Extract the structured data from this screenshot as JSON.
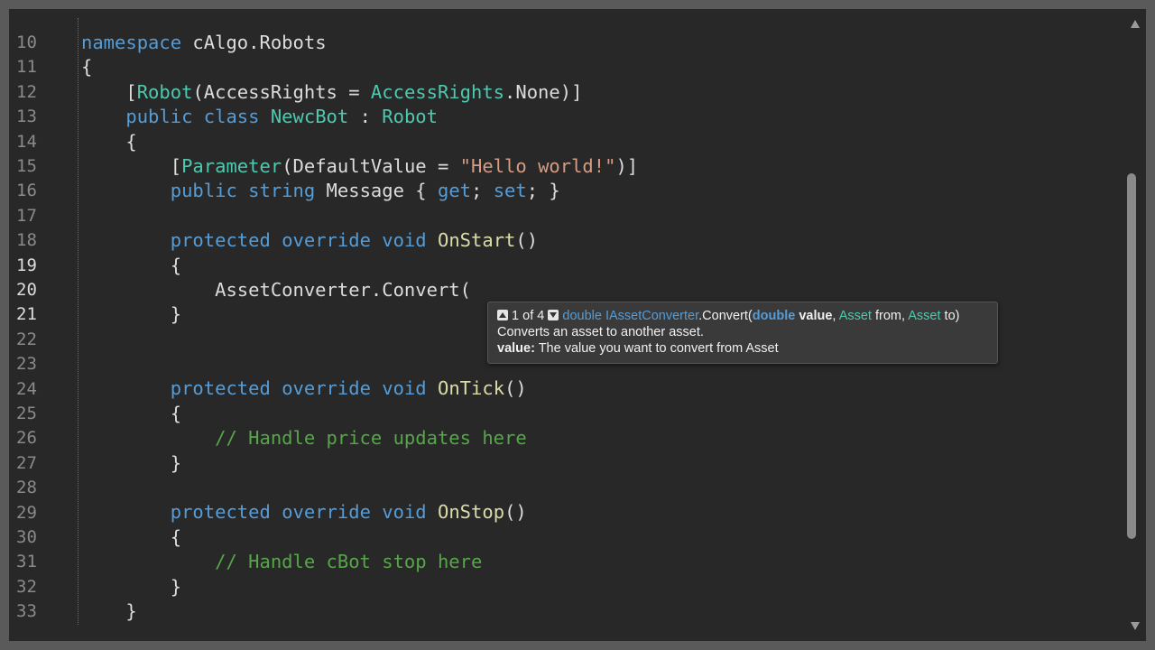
{
  "editor": {
    "line_numbers": [
      "10",
      "11",
      "12",
      "13",
      "14",
      "15",
      "16",
      "17",
      "18",
      "19",
      "20",
      "21",
      "22",
      "23",
      "24",
      "25",
      "26",
      "27",
      "28",
      "29",
      "30",
      "31",
      "32",
      "33"
    ],
    "active_lines": [
      "19",
      "20",
      "21"
    ],
    "code": {
      "l10": {
        "kw": "namespace",
        "rest": " cAlgo.Robots"
      },
      "l11": {
        "text": "{"
      },
      "l12": {
        "indent": "    ",
        "open": "[",
        "attr": "Robot",
        "mid": "(AccessRights = ",
        "type": "AccessRights",
        "end": ".None)]"
      },
      "l13": {
        "indent": "    ",
        "kw1": "public",
        "kw2": "class",
        "name": "NewcBot",
        "colon": " : ",
        "base": "Robot"
      },
      "l14": {
        "text": "    {"
      },
      "l15": {
        "indent": "        ",
        "open": "[",
        "attr": "Parameter",
        "mid": "(DefaultValue = ",
        "str": "\"Hello world!\"",
        "end": ")]"
      },
      "l16": {
        "indent": "        ",
        "kw1": "public",
        "kw2": "string",
        "mid": " Message { ",
        "get": "get",
        "semi1": "; ",
        "set": "set",
        "end": "; }"
      },
      "l17": {
        "text": ""
      },
      "l18": {
        "indent": "        ",
        "kw1": "protected",
        "kw2": "override",
        "kw3": "void",
        "method": "OnStart",
        "end": "()"
      },
      "l19": {
        "text": "        {"
      },
      "l20": {
        "text": "            AssetConverter.Convert("
      },
      "l21": {
        "text": "        }"
      },
      "l22": {
        "text": ""
      },
      "l23": {
        "text": ""
      },
      "l24": {
        "indent": "        ",
        "kw1": "protected",
        "kw2": "override",
        "kw3": "void",
        "method": "OnTick",
        "end": "()"
      },
      "l25": {
        "text": "        {"
      },
      "l26": {
        "indent": "            ",
        "comment": "// Handle price updates here"
      },
      "l27": {
        "text": "        }"
      },
      "l28": {
        "text": ""
      },
      "l29": {
        "indent": "        ",
        "kw1": "protected",
        "kw2": "override",
        "kw3": "void",
        "method": "OnStop",
        "end": "()"
      },
      "l30": {
        "text": "        {"
      },
      "l31": {
        "indent": "            ",
        "comment": "// Handle cBot stop here"
      },
      "l32": {
        "text": "        }"
      },
      "l33": {
        "text": "    }"
      }
    }
  },
  "tooltip": {
    "overload_counter": "1 of 4",
    "return_type": "double",
    "interface": "IAssetConverter",
    "method": ".Convert(",
    "p1_type": "double",
    "p1_name": "value",
    "sep1": ", ",
    "p2_type": "Asset",
    "p2_name": " from, ",
    "p3_type": "Asset",
    "p3_name": " to)",
    "description": "Converts an asset to another asset.",
    "param_label": "value:",
    "param_desc": " The value you want to convert from Asset"
  },
  "icons": {
    "prev_overload": "arrow-up-icon",
    "next_overload": "arrow-down-icon",
    "scroll_up": "scroll-up-icon",
    "scroll_down": "scroll-down-icon"
  },
  "colors": {
    "keyword": "#569cd6",
    "type": "#4ec9b0",
    "method": "#dcdcaa",
    "string": "#d69d85",
    "comment": "#57a64a",
    "background": "#282828"
  }
}
